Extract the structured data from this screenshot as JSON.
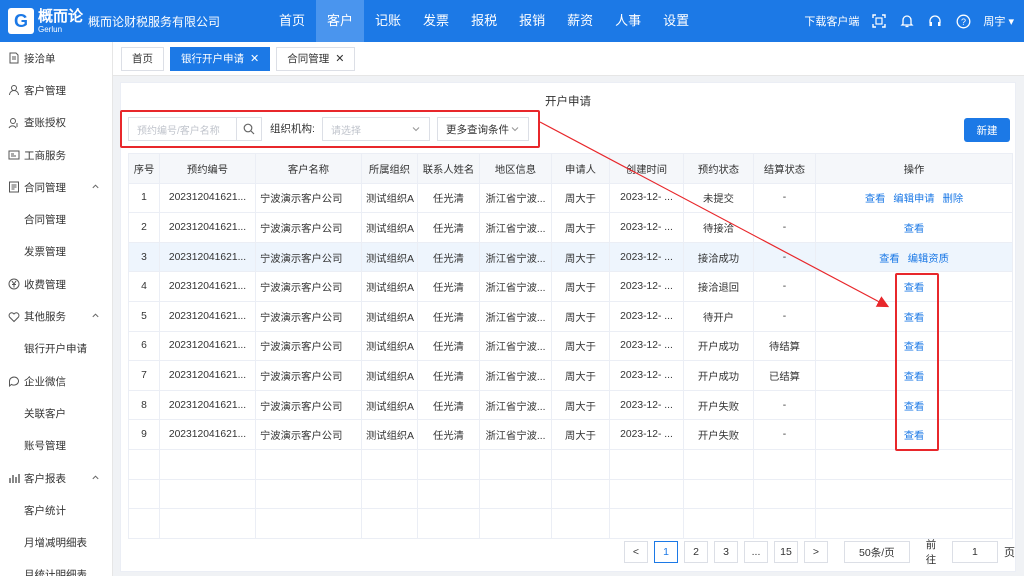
{
  "brand": {
    "logo_cn": "概而论",
    "logo_en": "Gerlun",
    "company": "概而论财税服务有限公司"
  },
  "nav": [
    "首页",
    "客户",
    "记账",
    "发票",
    "报税",
    "报销",
    "薪资",
    "人事",
    "设置"
  ],
  "top_right": {
    "download": "下载客户端",
    "user": "周宇 ▾"
  },
  "sidebar": [
    {
      "label": "接洽单",
      "icon": "document-icon"
    },
    {
      "label": "客户管理",
      "icon": "user-icon"
    },
    {
      "label": "查账授权",
      "icon": "user-key-icon"
    },
    {
      "label": "工商服务",
      "icon": "id-card-icon"
    },
    {
      "label": "合同管理",
      "icon": "contract-icon"
    },
    {
      "label": "合同管理",
      "icon": ""
    },
    {
      "label": "发票管理",
      "icon": ""
    },
    {
      "label": "收费管理",
      "icon": "money-icon"
    },
    {
      "label": "其他服务",
      "icon": "heart-icon"
    },
    {
      "label": "银行开户申请",
      "icon": ""
    },
    {
      "label": "企业微信",
      "icon": "chat-icon"
    },
    {
      "label": "关联客户",
      "icon": ""
    },
    {
      "label": "账号管理",
      "icon": ""
    },
    {
      "label": "客户报表",
      "icon": "bar-chart-icon"
    },
    {
      "label": "客户统计",
      "icon": ""
    },
    {
      "label": "月增减明细表",
      "icon": ""
    },
    {
      "label": "月统计明细表",
      "icon": ""
    }
  ],
  "tabs": {
    "home": "首页",
    "bank": "银行开户申请",
    "contract": "合同管理",
    "close": "✕"
  },
  "page": {
    "title": "开户申请"
  },
  "filters": {
    "search_placeholder": "预约编号/客户名称",
    "org_label": "组织机构:",
    "org_placeholder": "请选择",
    "more": "更多查询条件",
    "new": "新建"
  },
  "table": {
    "headers": [
      "序号",
      "预约编号",
      "客户名称",
      "所属组织",
      "联系人姓名",
      "地区信息",
      "申请人",
      "创建时间",
      "预约状态",
      "结算状态",
      "操作"
    ],
    "rows": [
      {
        "no": "1",
        "id": "202312041621...",
        "client": "宁波演示客户公司",
        "org": "测试组织A",
        "contact": "任光清",
        "region": "浙江省宁波...",
        "applicant": "周大于",
        "created": "2023-12- ...",
        "status": "未提交",
        "settle": "-",
        "ops": [
          "查看",
          "编辑申请",
          "删除"
        ]
      },
      {
        "no": "2",
        "id": "202312041621...",
        "client": "宁波演示客户公司",
        "org": "测试组织A",
        "contact": "任光清",
        "region": "浙江省宁波...",
        "applicant": "周大于",
        "created": "2023-12- ...",
        "status": "待接洽",
        "settle": "-",
        "ops": [
          "查看"
        ]
      },
      {
        "no": "3",
        "id": "202312041621...",
        "client": "宁波演示客户公司",
        "org": "测试组织A",
        "contact": "任光清",
        "region": "浙江省宁波...",
        "applicant": "周大于",
        "created": "2023-12- ...",
        "status": "接洽成功",
        "settle": "-",
        "ops": [
          "查看",
          "编辑资质"
        ]
      },
      {
        "no": "4",
        "id": "202312041621...",
        "client": "宁波演示客户公司",
        "org": "测试组织A",
        "contact": "任光清",
        "region": "浙江省宁波...",
        "applicant": "周大于",
        "created": "2023-12- ...",
        "status": "接洽退回",
        "settle": "-",
        "ops": [
          "查看"
        ]
      },
      {
        "no": "5",
        "id": "202312041621...",
        "client": "宁波演示客户公司",
        "org": "测试组织A",
        "contact": "任光清",
        "region": "浙江省宁波...",
        "applicant": "周大于",
        "created": "2023-12- ...",
        "status": "待开户",
        "settle": "-",
        "ops": [
          "查看"
        ]
      },
      {
        "no": "6",
        "id": "202312041621...",
        "client": "宁波演示客户公司",
        "org": "测试组织A",
        "contact": "任光清",
        "region": "浙江省宁波...",
        "applicant": "周大于",
        "created": "2023-12- ...",
        "status": "开户成功",
        "settle": "待结算",
        "ops": [
          "查看"
        ]
      },
      {
        "no": "7",
        "id": "202312041621...",
        "client": "宁波演示客户公司",
        "org": "测试组织A",
        "contact": "任光清",
        "region": "浙江省宁波...",
        "applicant": "周大于",
        "created": "2023-12- ...",
        "status": "开户成功",
        "settle": "已结算",
        "ops": [
          "查看"
        ]
      },
      {
        "no": "8",
        "id": "202312041621...",
        "client": "宁波演示客户公司",
        "org": "测试组织A",
        "contact": "任光清",
        "region": "浙江省宁波...",
        "applicant": "周大于",
        "created": "2023-12- ...",
        "status": "开户失败",
        "settle": "-",
        "ops": [
          "查看"
        ]
      },
      {
        "no": "9",
        "id": "202312041621...",
        "client": "宁波演示客户公司",
        "org": "测试组织A",
        "contact": "任光清",
        "region": "浙江省宁波...",
        "applicant": "周大于",
        "created": "2023-12- ...",
        "status": "开户失败",
        "settle": "-",
        "ops": [
          "查看"
        ]
      }
    ]
  },
  "pagination": {
    "prev": "<",
    "pages": [
      "1",
      "2",
      "3",
      "...",
      "15"
    ],
    "next": ">",
    "size": "50条/页",
    "goto_label": "前往",
    "goto_value": "1",
    "page_unit": "页"
  },
  "colors": {
    "primary": "#1c79e6",
    "annotation": "#e8272b"
  }
}
